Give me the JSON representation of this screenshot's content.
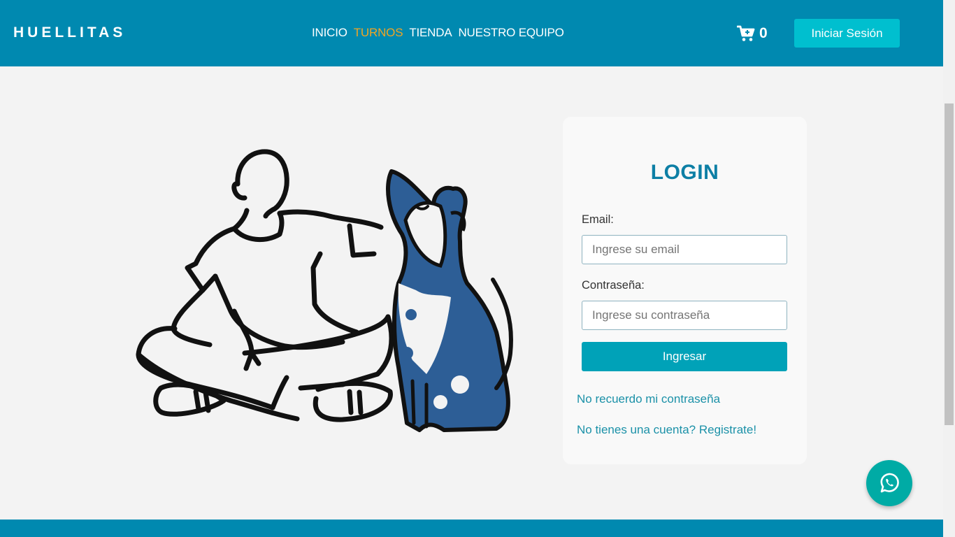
{
  "header": {
    "brand": "HUELLITAS",
    "nav": [
      "INICIO",
      "TURNOS",
      "TIENDA",
      "NUESTRO EQUIPO"
    ],
    "active_nav": "TURNOS",
    "cart_icon": "shopping-cart-icon",
    "cart_count": "0",
    "login_button": "Iniciar Sesión"
  },
  "illustration": {
    "icon": "person-with-dog-illustration"
  },
  "login": {
    "title": "LOGIN",
    "email_label": "Email:",
    "email_placeholder": "Ingrese su email",
    "password_label": "Contraseña:",
    "password_placeholder": "Ingrese su contraseña",
    "submit_label": "Ingresar",
    "forgot_link": "No recuerdo mi contraseña",
    "register_link": "No tienes una cuenta? Registrate!"
  },
  "whatsapp": {
    "icon": "whatsapp-icon"
  },
  "colors": {
    "header": "#0089b0",
    "accent": "#f0a524",
    "button": "#00bfcf",
    "title": "#0d7fa5",
    "fab": "#00aba5"
  }
}
